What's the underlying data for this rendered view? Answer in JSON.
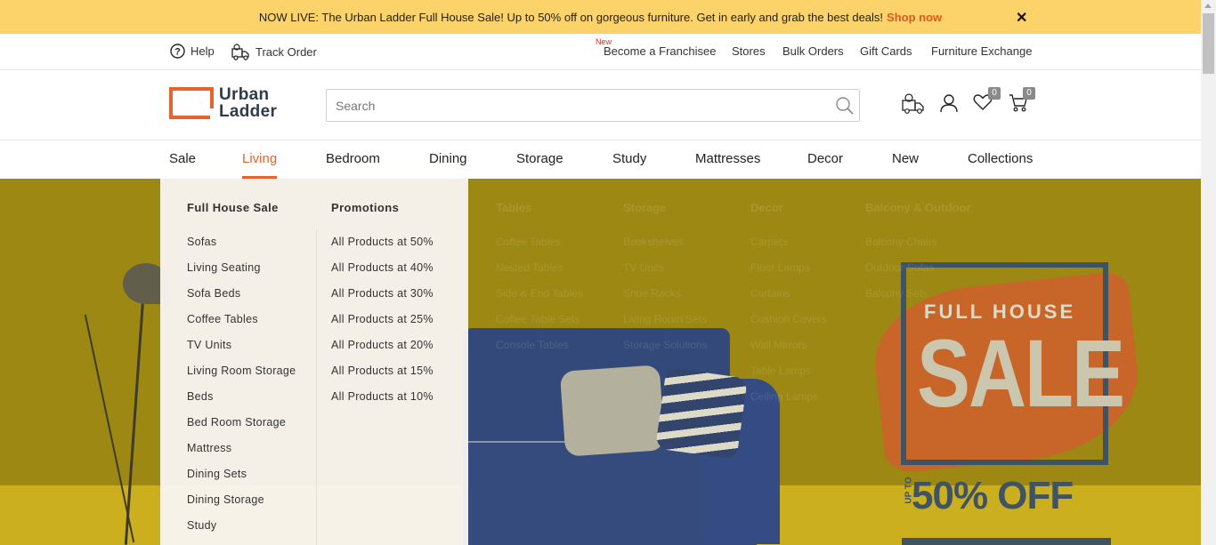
{
  "announcement": {
    "text": "NOW LIVE: The Urban Ladder Full House Sale! Up to 50% off on gorgeous furniture. Get in early and grab the best deals!",
    "cta": "Shop now",
    "close_symbol": "✕"
  },
  "utility": {
    "help": "Help",
    "track_order": "Track Order",
    "new_tag": "New",
    "links": [
      "Become a Franchisee",
      "Stores",
      "Bulk Orders",
      "Gift Cards",
      "Furniture Exchange"
    ]
  },
  "header": {
    "logo_line1": "Urban",
    "logo_line2": "Ladder",
    "search_placeholder": "Search",
    "wishlist_count": "0",
    "cart_count": "0"
  },
  "nav": {
    "items": [
      "Sale",
      "Living",
      "Bedroom",
      "Dining",
      "Storage",
      "Study",
      "Mattresses",
      "Decor",
      "New",
      "Collections"
    ],
    "active": "Living"
  },
  "dropdown": {
    "col1": {
      "heading": "Full House Sale",
      "links": [
        "Sofas",
        "Living Seating",
        "Sofa Beds",
        "Coffee Tables",
        "TV Units",
        "Living Room Storage",
        "Beds",
        "Bed Room Storage",
        "Mattress",
        "Dining Sets",
        "Dining Storage",
        "Study"
      ]
    },
    "col2": {
      "heading": "Promotions",
      "links": [
        "All Products at 50%",
        "All Products at 40%",
        "All Products at 30%",
        "All Products at 25%",
        "All Products at 20%",
        "All Products at 15%",
        "All Products at 10%"
      ]
    }
  },
  "hero": {
    "promo_top": "FULL HOUSE",
    "promo_main": "SALE",
    "promo_upto": "UP TO",
    "promo_off": "50% OFF"
  },
  "ghost_menu": {
    "headings": [
      "Tables",
      "Storage",
      "Decor",
      "Balcony & Outdoor"
    ],
    "tables": [
      "Coffee Tables",
      "Nested Tables",
      "Side & End Tables",
      "Coffee Table Sets",
      "Console Tables"
    ],
    "storage": [
      "Bookshelves",
      "TV Units",
      "Shoe Racks",
      "Living Room Sets",
      "Storage Solutions"
    ],
    "decor": [
      "Carpets",
      "Floor Lamps",
      "Curtains",
      "Cushion Covers",
      "Wall Mirrors",
      "Table Lamps",
      "Ceiling Lamps"
    ],
    "balcony": [
      "Balcony Chairs",
      "Outdoor Sofas",
      "Balcony Sets"
    ]
  },
  "colors": {
    "accent": "#e8632c",
    "announcement_bg": "#fcd26a",
    "new_tag": "#e0321f",
    "promo_navy": "#2e4a78"
  },
  "icons": [
    "help-icon",
    "truck-icon",
    "search-icon",
    "delivery-icon",
    "user-icon",
    "heart-icon",
    "cart-icon",
    "close-icon"
  ]
}
